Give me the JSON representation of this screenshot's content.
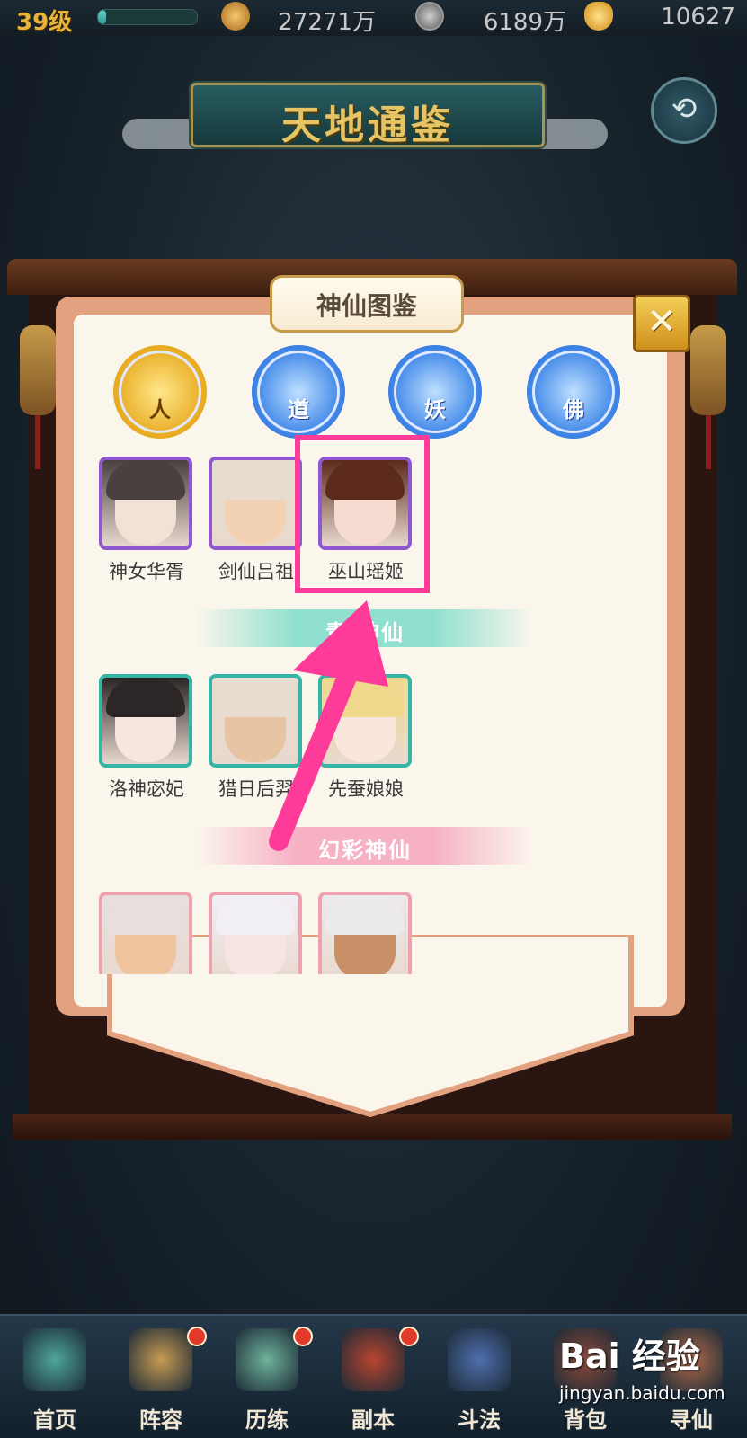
{
  "topbar": {
    "level": "39级",
    "xp_progress": 0.08,
    "resources": [
      {
        "icon": "combat-power-icon",
        "value": "27271万"
      },
      {
        "icon": "coin-icon",
        "value": "6189万"
      },
      {
        "icon": "gold-ingot-icon",
        "value": "10627"
      }
    ]
  },
  "header": {
    "title": "天地通鉴",
    "back_icon": "back-arrow-icon",
    "back_glyph": "⟲"
  },
  "panel": {
    "title": "神仙图鉴",
    "close_glyph": "✕",
    "tabs": [
      {
        "label": "人",
        "active": true
      },
      {
        "label": "道",
        "active": false
      },
      {
        "label": "妖",
        "active": false
      },
      {
        "label": "佛",
        "active": false
      }
    ],
    "purple_heroes": [
      {
        "name": "神女华胥",
        "hair": "#4a4040",
        "skin": "#f3e1d6"
      },
      {
        "name": "剑仙吕祖",
        "hair": "#e6ddd0",
        "skin": "#f2d2b3"
      },
      {
        "name": "巫山瑶姬",
        "hair": "#5b2a1c",
        "skin": "#f6dcd0"
      }
    ],
    "section_teal": "青 神仙",
    "teal_heroes": [
      {
        "name": "洛神宓妃",
        "hair": "#2c2626",
        "skin": "#f7e6e0"
      },
      {
        "name": "猎日后羿",
        "hair": "#e7dccf",
        "skin": "#e6c4a4"
      },
      {
        "name": "先蚕娘娘",
        "hair": "#f0d98c",
        "skin": "#fae6dc"
      }
    ],
    "section_pink": "幻彩神仙",
    "pink_heroes": [
      {
        "hair": "#e8dede",
        "skin": "#f0c49e"
      },
      {
        "hair": "#f1eef4",
        "skin": "#f7e5e4"
      },
      {
        "hair": "#eceaea",
        "skin": "#c99067"
      }
    ]
  },
  "colors": {
    "highlight": "#ff3b9a",
    "purple_frame": "#8f57d0",
    "teal_frame": "#34b5a5",
    "pink_frame": "#eea2b0"
  },
  "bottom_nav": [
    {
      "label": "首页",
      "icon": "home-icon",
      "dot": false
    },
    {
      "label": "阵容",
      "icon": "lineup-icon",
      "dot": true
    },
    {
      "label": "历练",
      "icon": "training-icon",
      "dot": true
    },
    {
      "label": "副本",
      "icon": "dungeon-icon",
      "dot": true
    },
    {
      "label": "斗法",
      "icon": "battle-icon",
      "dot": false
    },
    {
      "label": "背包",
      "icon": "bag-icon",
      "dot": false
    },
    {
      "label": "寻仙",
      "icon": "seek-immortal-icon",
      "dot": false
    }
  ],
  "watermark": {
    "logo": "Bai 经验",
    "url": "jingyan.baidu.com"
  }
}
